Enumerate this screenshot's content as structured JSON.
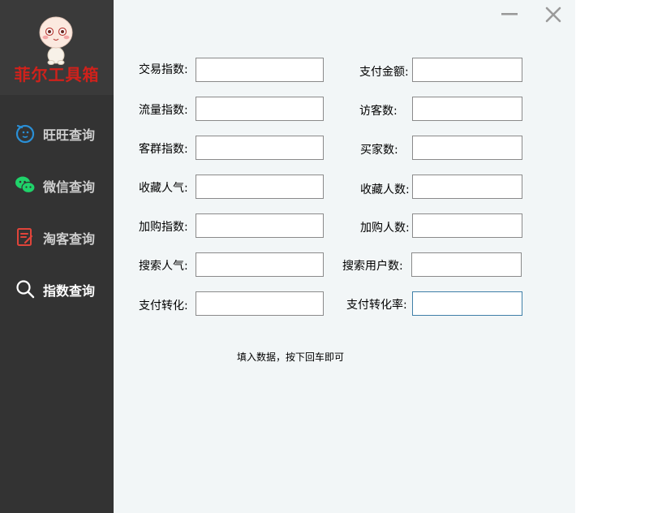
{
  "app": {
    "logo_text": "菲尔工具箱"
  },
  "sidebar": {
    "items": [
      {
        "label": "旺旺查询"
      },
      {
        "label": "微信查询"
      },
      {
        "label": "淘客查询"
      },
      {
        "label": "指数查询"
      }
    ]
  },
  "form": {
    "left": [
      {
        "label": "交易指数:",
        "value": ""
      },
      {
        "label": "流量指数:",
        "value": ""
      },
      {
        "label": "客群指数:",
        "value": ""
      },
      {
        "label": "收藏人气:",
        "value": ""
      },
      {
        "label": "加购指数:",
        "value": ""
      },
      {
        "label": "搜索人气:",
        "value": ""
      },
      {
        "label": "支付转化:",
        "value": ""
      }
    ],
    "right": [
      {
        "label": "支付金额:",
        "value": ""
      },
      {
        "label": "访客数:",
        "value": ""
      },
      {
        "label": "买家数:",
        "value": ""
      },
      {
        "label": "收藏人数:",
        "value": ""
      },
      {
        "label": "加购人数:",
        "value": ""
      },
      {
        "label": "搜索用户数:",
        "value": ""
      },
      {
        "label": "支付转化率:",
        "value": ""
      }
    ],
    "hint": "填入数据，按下回车即可"
  },
  "colors": {
    "sidebar_bg": "#333333",
    "logo_red": "#d0211b",
    "wangwang_blue": "#2a8fd6",
    "wechat_green": "#1fd36a",
    "taoke_red": "#e0443a",
    "focus_border": "#3f7fa8"
  }
}
